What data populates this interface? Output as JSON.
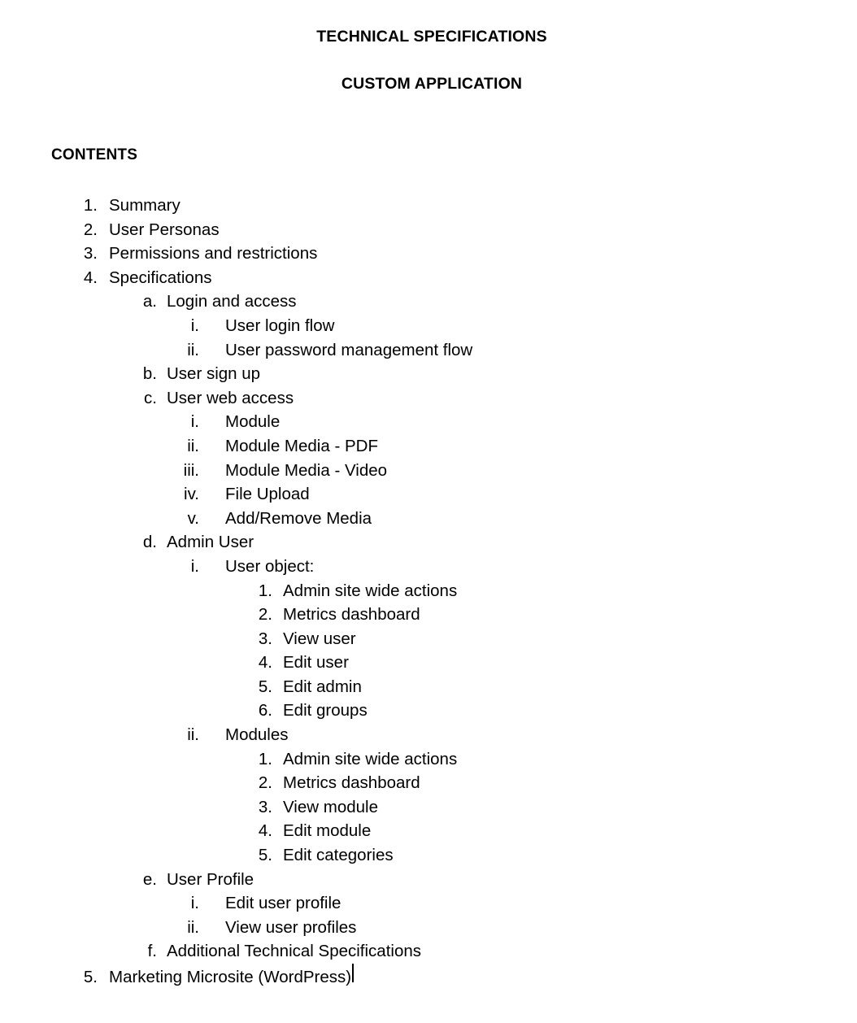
{
  "document": {
    "title_line_1": "TECHNICAL SPECIFICATIONS",
    "title_line_2": "CUSTOM APPLICATION",
    "contents_heading": "CONTENTS"
  },
  "outline": [
    {
      "level": 1,
      "marker": "1.",
      "label": "Summary"
    },
    {
      "level": 1,
      "marker": "2.",
      "label": "User Personas"
    },
    {
      "level": 1,
      "marker": "3.",
      "label": "Permissions and restrictions"
    },
    {
      "level": 1,
      "marker": "4.",
      "label": "Specifications"
    },
    {
      "level": 2,
      "marker": "a.",
      "label": "Login and access"
    },
    {
      "level": 3,
      "marker": "i.",
      "label": "User login flow"
    },
    {
      "level": 3,
      "marker": "ii.",
      "label": "User password management flow"
    },
    {
      "level": 2,
      "marker": "b.",
      "label": "User sign up"
    },
    {
      "level": 2,
      "marker": "c.",
      "label": "User web access"
    },
    {
      "level": 3,
      "marker": "i.",
      "label": "Module"
    },
    {
      "level": 3,
      "marker": "ii.",
      "label": "Module Media - PDF"
    },
    {
      "level": 3,
      "marker": "iii.",
      "label": "Module Media - Video"
    },
    {
      "level": 3,
      "marker": "iv.",
      "label": "File Upload"
    },
    {
      "level": 3,
      "marker": "v.",
      "label": "Add/Remove Media"
    },
    {
      "level": 2,
      "marker": "d.",
      "label": "Admin User"
    },
    {
      "level": 3,
      "marker": "i.",
      "label": "User object:"
    },
    {
      "level": 4,
      "marker": "1.",
      "label": "Admin site wide actions"
    },
    {
      "level": 4,
      "marker": "2.",
      "label": "Metrics dashboard"
    },
    {
      "level": 4,
      "marker": "3.",
      "label": "View user"
    },
    {
      "level": 4,
      "marker": "4.",
      "label": "Edit user"
    },
    {
      "level": 4,
      "marker": "5.",
      "label": "Edit admin"
    },
    {
      "level": 4,
      "marker": "6.",
      "label": "Edit groups"
    },
    {
      "level": 3,
      "marker": "ii.",
      "label": "Modules"
    },
    {
      "level": 4,
      "marker": "1.",
      "label": "Admin site wide actions"
    },
    {
      "level": 4,
      "marker": "2.",
      "label": "Metrics dashboard"
    },
    {
      "level": 4,
      "marker": "3.",
      "label": "View module"
    },
    {
      "level": 4,
      "marker": "4.",
      "label": "Edit module"
    },
    {
      "level": 4,
      "marker": "5.",
      "label": "Edit categories"
    },
    {
      "level": 2,
      "marker": "e.",
      "label": "User Profile"
    },
    {
      "level": 3,
      "marker": "i.",
      "label": "Edit user profile"
    },
    {
      "level": 3,
      "marker": "ii.",
      "label": "View user profiles"
    },
    {
      "level": 2,
      "marker": "f.",
      "label": "Additional Technical Specifications"
    },
    {
      "level": 1,
      "marker": "5.",
      "label": "Marketing Microsite (WordPress)",
      "caret": true
    }
  ],
  "colors": {
    "text": "#000000",
    "background": "#ffffff"
  }
}
